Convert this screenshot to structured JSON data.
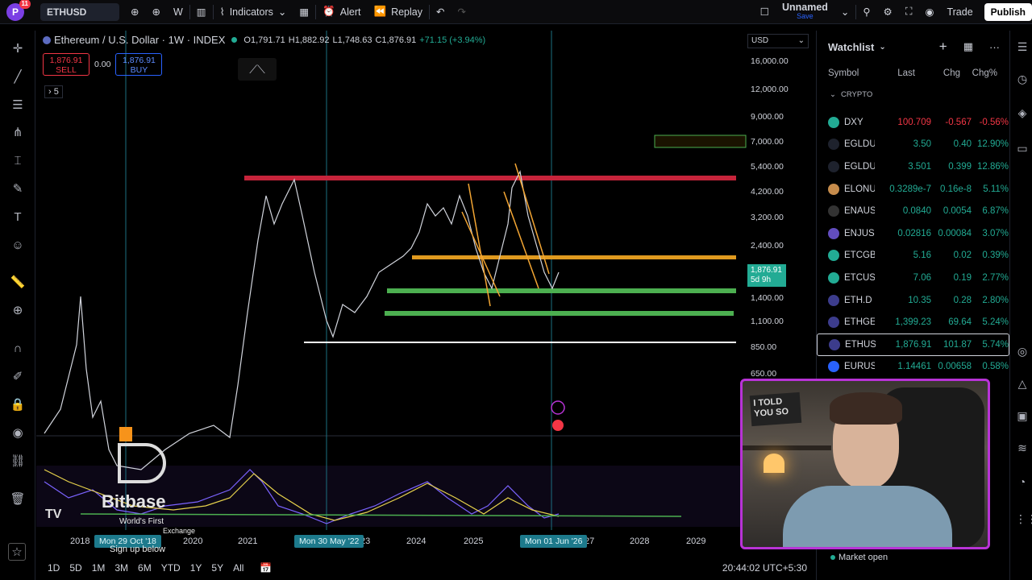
{
  "topbar": {
    "avatar_letter": "P",
    "notifications": "11",
    "symbol": "ETHUSD",
    "interval": "W",
    "indicators": "Indicators",
    "alert": "Alert",
    "replay": "Replay",
    "layout_name": "Unnamed",
    "layout_status": "Save",
    "trade": "Trade",
    "publish": "Publish"
  },
  "legend": {
    "title": "Ethereum / U.S. Dollar · 1W · INDEX",
    "open": "O1,791.71",
    "high": "H1,882.92",
    "low": "L1,748.63",
    "close": "C1,876.91",
    "change": "+71.15 (+3.94%)",
    "sell_price": "1,876.91",
    "sell_label": "SELL",
    "spread": "0.00",
    "buy_price": "1,876.91",
    "buy_label": "BUY",
    "indicator_count": "5"
  },
  "axis": {
    "currency": "USD",
    "price_labels": [
      "16,000.00",
      "12,000.00",
      "9,000.00",
      "7,000.00",
      "5,400.00",
      "4,200.00",
      "3,200.00",
      "2,400.00",
      "1,400.00",
      "1,100.00",
      "850.00",
      "650.00"
    ],
    "current_price": "1,876.91",
    "countdown": "5d 9h",
    "x_labels": [
      "2018",
      "2020",
      "2021",
      "2024",
      "2025",
      "2028",
      "2029"
    ],
    "x_partial": [
      "23",
      "27"
    ],
    "x_highlights": [
      "Mon 29 Oct '18",
      "Mon 30 May '22",
      "Mon 01 Jun '26"
    ]
  },
  "bottombar": {
    "ranges": [
      "1D",
      "5D",
      "1M",
      "3M",
      "6M",
      "YTD",
      "1Y",
      "5Y",
      "All"
    ],
    "clock": "20:44:02 UTC+5:30"
  },
  "watermark": {
    "brand": "Bitbase",
    "tagline1": "World's First",
    "tagline2": "Exchange",
    "cta": "Sign up below"
  },
  "watchlist": {
    "title": "Watchlist",
    "columns": [
      "Symbol",
      "Last",
      "Chg",
      "Chg%"
    ],
    "section": "CRYPTO",
    "rows": [
      {
        "sym": "DXY",
        "last": "100.709",
        "chg": "-0.567",
        "chgp": "-0.56%",
        "dir": "neg",
        "icon": "dollar-icon",
        "color": "#22ab94"
      },
      {
        "sym": "EGLDU",
        "last": "3.50",
        "chg": "0.40",
        "chgp": "12.90%",
        "dir": "pos",
        "icon": "egld-icon",
        "color": "#1e222d"
      },
      {
        "sym": "EGLDU",
        "last": "3.501",
        "chg": "0.399",
        "chgp": "12.86%",
        "dir": "pos",
        "icon": "egld-icon",
        "color": "#1e222d"
      },
      {
        "sym": "ELONU",
        "last": "0.3289e-7",
        "chg": "0.16e-8",
        "chgp": "5.11%",
        "dir": "pos",
        "icon": "elon-icon",
        "color": "#c58b4b"
      },
      {
        "sym": "ENAUS",
        "last": "0.0840",
        "chg": "0.0054",
        "chgp": "6.87%",
        "dir": "pos",
        "icon": "ena-icon",
        "color": "#333"
      },
      {
        "sym": "ENJUS",
        "last": "0.02816",
        "chg": "0.00084",
        "chgp": "3.07%",
        "dir": "pos",
        "icon": "enj-icon",
        "color": "#624dbf"
      },
      {
        "sym": "ETCGB",
        "last": "5.16",
        "chg": "0.02",
        "chgp": "0.39%",
        "dir": "pos",
        "icon": "etc-icon",
        "color": "#22ab94"
      },
      {
        "sym": "ETCUS",
        "last": "7.06",
        "chg": "0.19",
        "chgp": "2.77%",
        "dir": "pos",
        "icon": "etc-icon",
        "color": "#22ab94"
      },
      {
        "sym": "ETH.D",
        "last": "10.35",
        "chg": "0.28",
        "chgp": "2.80%",
        "dir": "pos",
        "icon": "eth-icon",
        "color": "#3c3c8c"
      },
      {
        "sym": "ETHGE",
        "last": "1,399.23",
        "chg": "69.64",
        "chgp": "5.24%",
        "dir": "pos",
        "icon": "eth-icon",
        "color": "#3c3c8c"
      },
      {
        "sym": "ETHUS",
        "last": "1,876.91",
        "chg": "101.87",
        "chgp": "5.74%",
        "dir": "pos",
        "icon": "eth-icon",
        "color": "#3c3c8c"
      },
      {
        "sym": "EURUS",
        "last": "1.14461",
        "chg": "0.00658",
        "chgp": "0.58%",
        "dir": "pos",
        "icon": "euro-icon",
        "color": "#2962ff"
      }
    ],
    "market_status": "Market open"
  },
  "webcam": {
    "shirt_text1": "I TOLD",
    "shirt_text2": "YOU SO"
  },
  "colors": {
    "up": "#22ab94",
    "down": "#f23645",
    "accent": "#2962ff",
    "webcam_border": "#b833d6"
  }
}
